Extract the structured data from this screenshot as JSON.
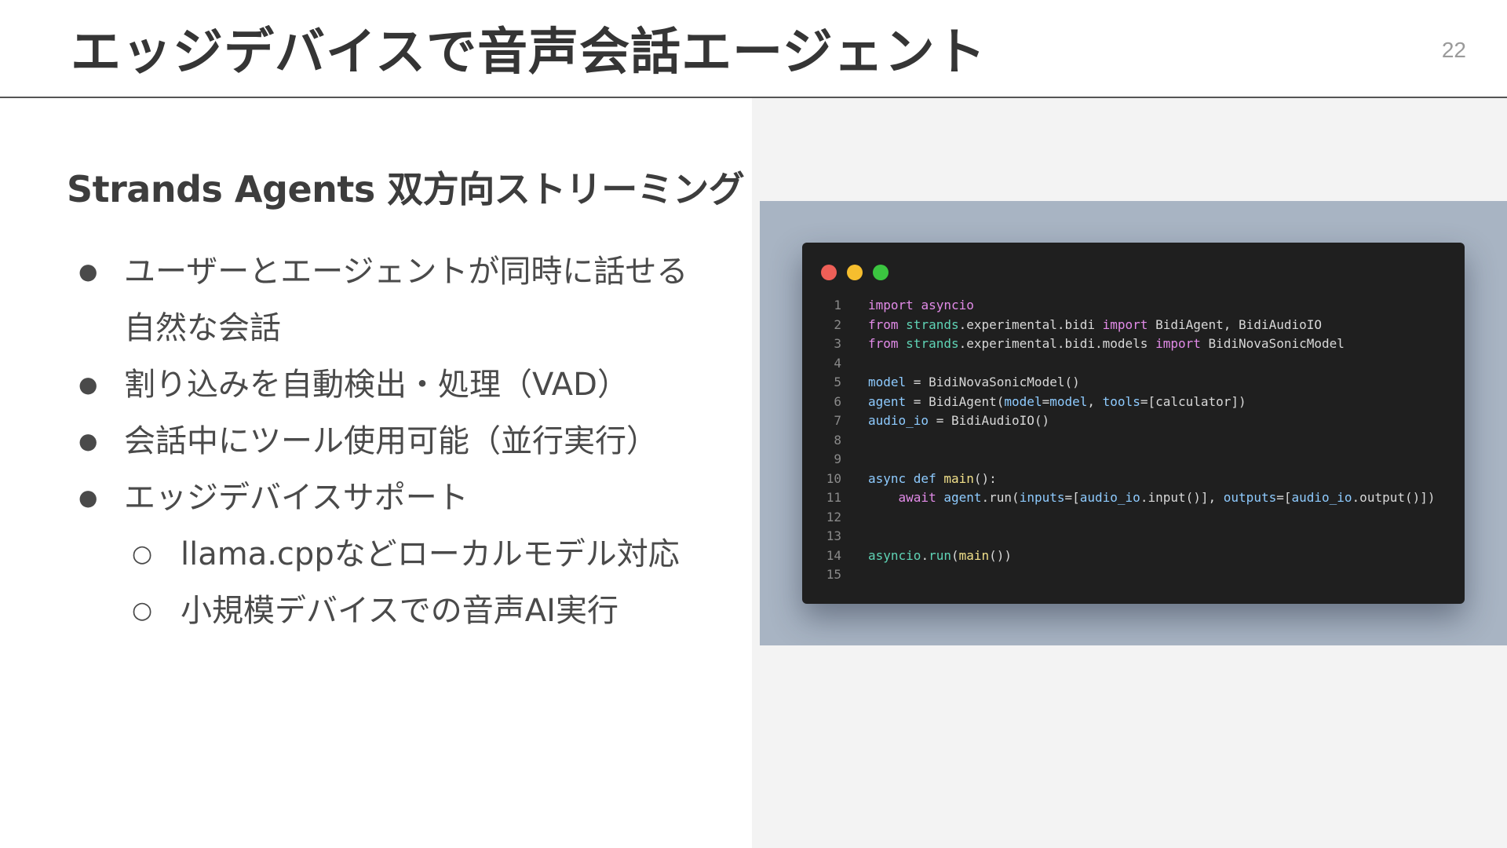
{
  "slide": {
    "title": "エッジデバイスで音声会話エージェント",
    "page_number": "22",
    "subtitle": "Strands Agents 双方向ストリーミング"
  },
  "bullets": [
    {
      "level": 1,
      "marker": "●",
      "text": "ユーザーとエージェントが同時に話せる"
    },
    {
      "level": 1,
      "marker": "",
      "text": "自然な会話"
    },
    {
      "level": 1,
      "marker": "●",
      "text": "割り込みを自動検出・処理（VAD）"
    },
    {
      "level": 1,
      "marker": "●",
      "text": "会話中にツール使用可能（並行実行）"
    },
    {
      "level": 1,
      "marker": "●",
      "text": "エッジデバイスサポート"
    },
    {
      "level": 2,
      "marker": "○",
      "text": "llama.cppなどローカルモデル対応"
    },
    {
      "level": 2,
      "marker": "○",
      "text": "小規模デバイスでの音声AI実行"
    }
  ],
  "code_window": {
    "dots": [
      "#ee5f57",
      "#f6be2e",
      "#3bc540"
    ],
    "colors": {
      "keyword": "#e28be8",
      "module": "#5fd3b5",
      "variable": "#8ecbff",
      "func": "#f1e08a",
      "plain": "#d8d8d8",
      "line_number": "#8a8a8a"
    },
    "lines": [
      {
        "n": "1",
        "tokens": [
          {
            "t": "import",
            "c": "keyword"
          },
          {
            "t": " "
          },
          {
            "t": "asyncio",
            "c": "keyword"
          }
        ]
      },
      {
        "n": "2",
        "tokens": [
          {
            "t": "from",
            "c": "keyword"
          },
          {
            "t": " "
          },
          {
            "t": "strands",
            "c": "module"
          },
          {
            "t": ".experimental.bidi "
          },
          {
            "t": "import",
            "c": "keyword"
          },
          {
            "t": " BidiAgent, BidiAudioIO"
          }
        ]
      },
      {
        "n": "3",
        "tokens": [
          {
            "t": "from",
            "c": "keyword"
          },
          {
            "t": " "
          },
          {
            "t": "strands",
            "c": "module"
          },
          {
            "t": ".experimental.bidi.models "
          },
          {
            "t": "import",
            "c": "keyword"
          },
          {
            "t": " BidiNovaSonicModel"
          }
        ]
      },
      {
        "n": "4",
        "tokens": []
      },
      {
        "n": "5",
        "tokens": [
          {
            "t": "model",
            "c": "variable"
          },
          {
            "t": " = BidiNovaSonicModel()"
          }
        ]
      },
      {
        "n": "6",
        "tokens": [
          {
            "t": "agent",
            "c": "variable"
          },
          {
            "t": " = BidiAgent("
          },
          {
            "t": "model",
            "c": "variable"
          },
          {
            "t": "="
          },
          {
            "t": "model",
            "c": "variable"
          },
          {
            "t": ", "
          },
          {
            "t": "tools",
            "c": "variable"
          },
          {
            "t": "=[calculator])"
          }
        ]
      },
      {
        "n": "7",
        "tokens": [
          {
            "t": "audio_io",
            "c": "variable"
          },
          {
            "t": " = BidiAudioIO()"
          }
        ]
      },
      {
        "n": "8",
        "tokens": []
      },
      {
        "n": "9",
        "tokens": []
      },
      {
        "n": "10",
        "tokens": [
          {
            "t": "async def",
            "c": "variable"
          },
          {
            "t": " "
          },
          {
            "t": "main",
            "c": "func"
          },
          {
            "t": "():"
          }
        ]
      },
      {
        "n": "11",
        "tokens": [
          {
            "t": "    "
          },
          {
            "t": "await",
            "c": "keyword"
          },
          {
            "t": " "
          },
          {
            "t": "agent",
            "c": "variable"
          },
          {
            "t": ".run("
          },
          {
            "t": "inputs",
            "c": "variable"
          },
          {
            "t": "=["
          },
          {
            "t": "audio_io",
            "c": "variable"
          },
          {
            "t": ".input()], "
          },
          {
            "t": "outputs",
            "c": "variable"
          },
          {
            "t": "=["
          },
          {
            "t": "audio_io",
            "c": "variable"
          },
          {
            "t": ".output()])"
          }
        ]
      },
      {
        "n": "12",
        "tokens": []
      },
      {
        "n": "13",
        "tokens": []
      },
      {
        "n": "14",
        "tokens": [
          {
            "t": "asyncio",
            "c": "module"
          },
          {
            "t": "."
          },
          {
            "t": "run",
            "c": "module"
          },
          {
            "t": "("
          },
          {
            "t": "main",
            "c": "func"
          },
          {
            "t": "())"
          }
        ]
      },
      {
        "n": "15",
        "tokens": []
      }
    ]
  }
}
